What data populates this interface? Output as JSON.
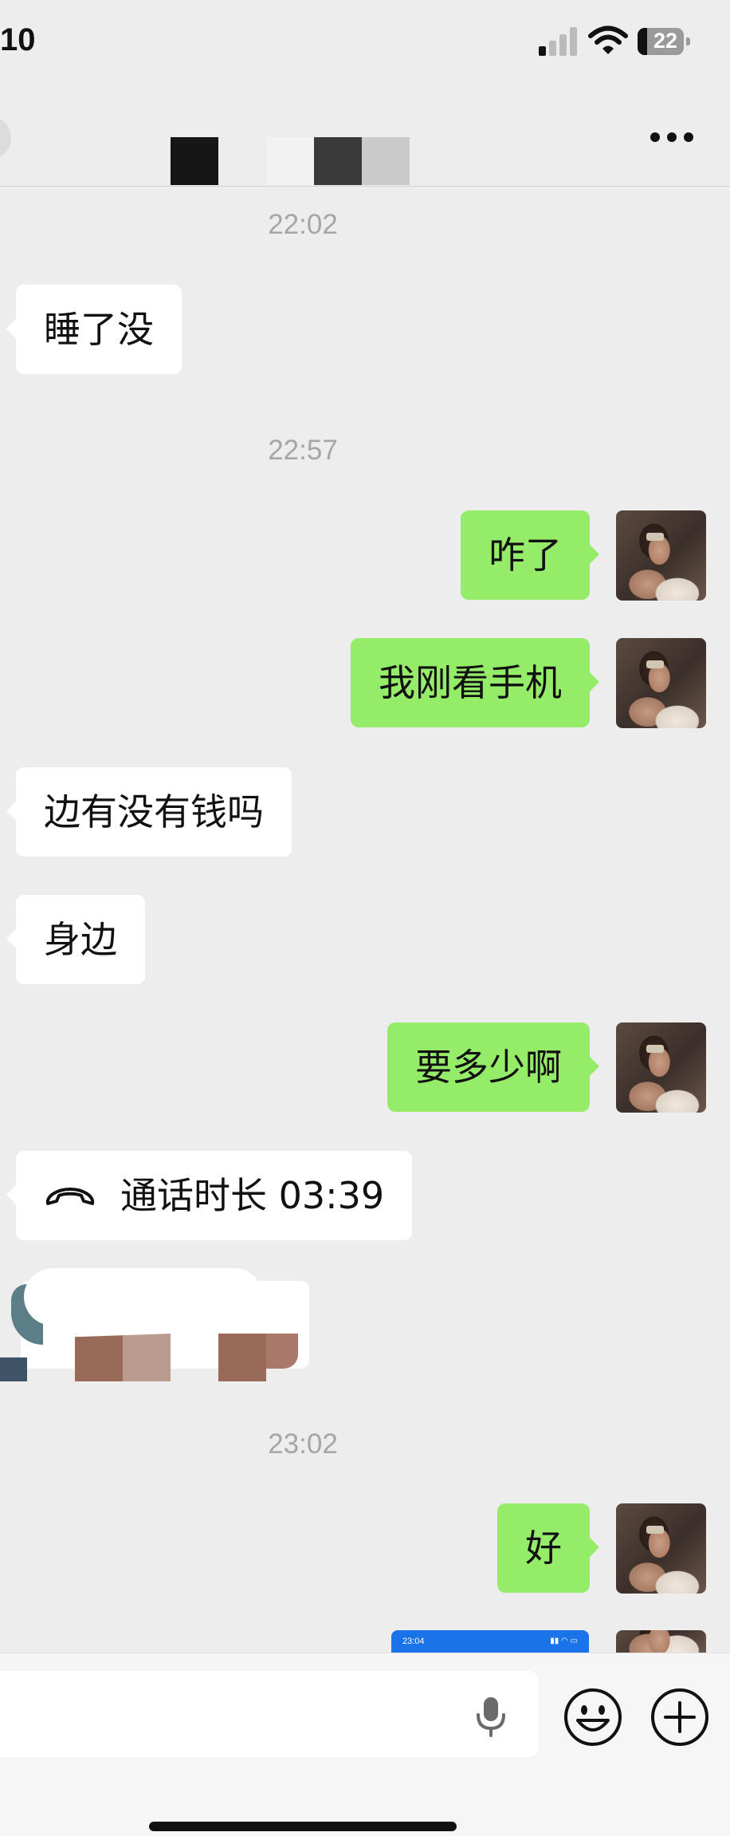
{
  "status_bar": {
    "time": "10",
    "battery": "22"
  },
  "chat_header": {
    "title": "",
    "more_label": "…"
  },
  "messages": {
    "ts1": "22:02",
    "m1": "睡了没",
    "ts2": "22:57",
    "m2": "咋了",
    "m3": "我刚看手机",
    "m4": "边有没有钱吗",
    "m5": "身边",
    "m6": "要多少啊",
    "call": "通话时长 03:39",
    "ts3": "23:02",
    "m7": "好",
    "screenshot_time": "23:04"
  },
  "colors": {
    "sent_bubble": "#95ec69",
    "received_bubble": "#ffffff",
    "chat_background": "#ededed"
  },
  "icons": [
    "signal-icon",
    "wifi-icon",
    "battery-icon",
    "more-icon",
    "phone-hangup-icon",
    "mic-icon",
    "emoji-icon",
    "plus-icon"
  ]
}
